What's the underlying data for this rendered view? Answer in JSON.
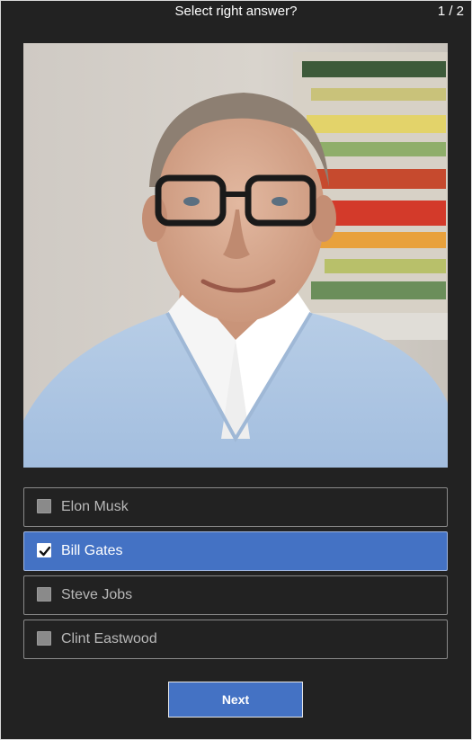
{
  "header": {
    "title": "Select right answer?",
    "counter": "1 / 2"
  },
  "photo": {
    "subject": "portrait photo of a man with glasses in a light blue sweater"
  },
  "options": [
    {
      "label": "Elon Musk",
      "checked": false
    },
    {
      "label": "Bill Gates",
      "checked": true
    },
    {
      "label": "Steve Jobs",
      "checked": false
    },
    {
      "label": "Clint Eastwood",
      "checked": false
    }
  ],
  "next_button": {
    "label": "Next"
  },
  "colors": {
    "background": "#222222",
    "accent": "#4472c4",
    "option_border": "#8a8a8a",
    "text": "#ffffff",
    "muted_text": "#b8b8b8"
  }
}
